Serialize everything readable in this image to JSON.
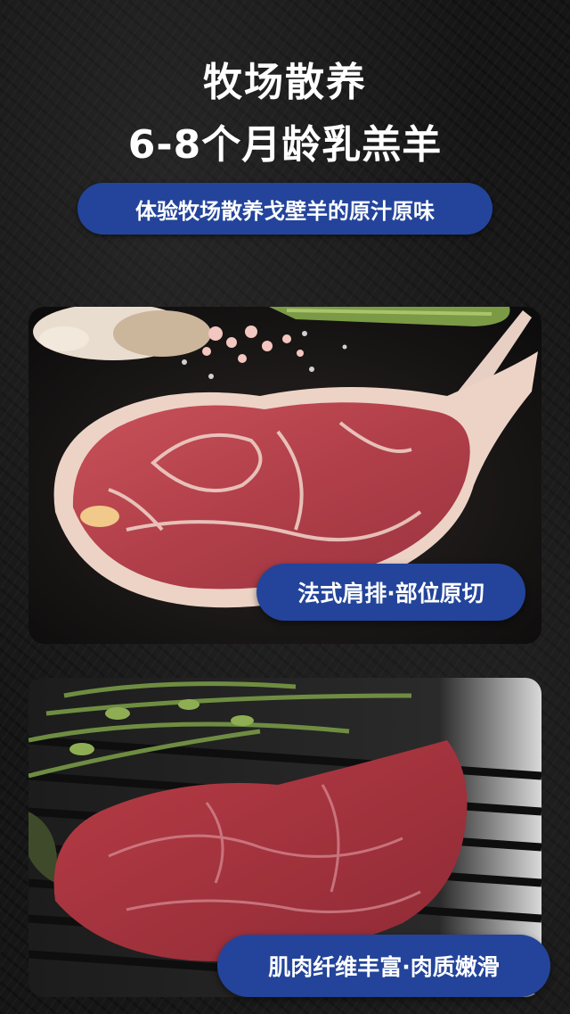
{
  "header": {
    "title_line1": "牧场散养",
    "title_line2": "6-8个月龄乳羔羊",
    "subtitle": "体验牧场散养戈壁羊的原汁原味"
  },
  "photos": [
    {
      "icon": "lamb-chop-image",
      "caption": "法式肩排·部位原切"
    },
    {
      "icon": "lamb-steak-grill-image",
      "caption": "肌肉纤维丰富·肉质嫩滑"
    }
  ],
  "colors": {
    "accent": "#23449a",
    "background": "#161616"
  }
}
